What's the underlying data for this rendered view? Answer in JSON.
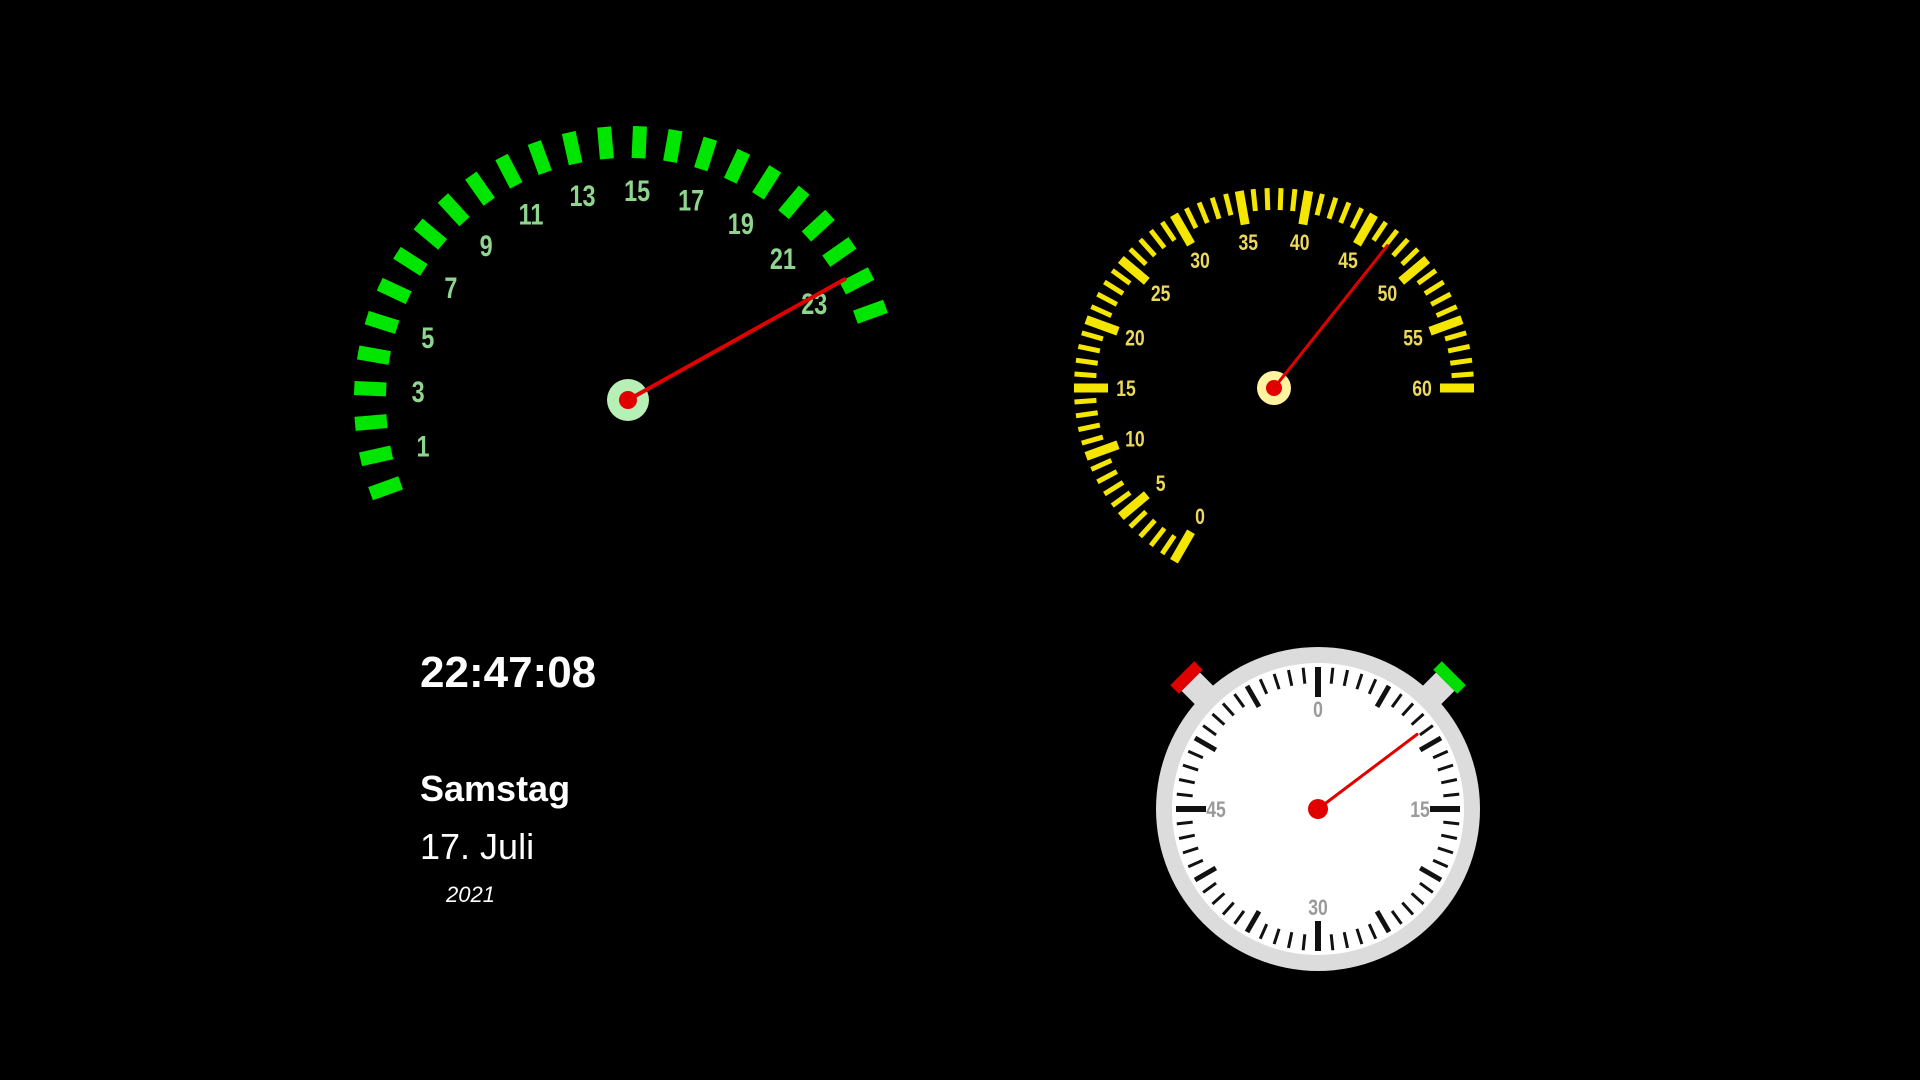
{
  "hour_gauge": {
    "labels": [
      "1",
      "3",
      "5",
      "7",
      "9",
      "11",
      "13",
      "15",
      "17",
      "19",
      "21",
      "23"
    ],
    "value": 22.78,
    "tick_color": "#00e600",
    "label_color": "#8fd48f",
    "needle_color": "#e00000"
  },
  "minute_gauge": {
    "labels": [
      "0",
      "5",
      "10",
      "15",
      "20",
      "25",
      "30",
      "35",
      "40",
      "45",
      "50",
      "55",
      "60"
    ],
    "value": 47.13,
    "tick_color": "#f5e600",
    "label_color": "#ecd85a",
    "needle_color": "#e00000"
  },
  "stopwatch": {
    "labels": [
      "0",
      "15",
      "30",
      "45"
    ],
    "value": 8,
    "face_color": "#ffffff",
    "bezel_color": "#dcdcdc",
    "needle_color": "#e00000",
    "left_button_color": "#e00000",
    "right_button_color": "#00dd00"
  },
  "clock": {
    "time": "22:47:08",
    "weekday": "Samstag",
    "date": "17. Juli",
    "year": "2021"
  }
}
